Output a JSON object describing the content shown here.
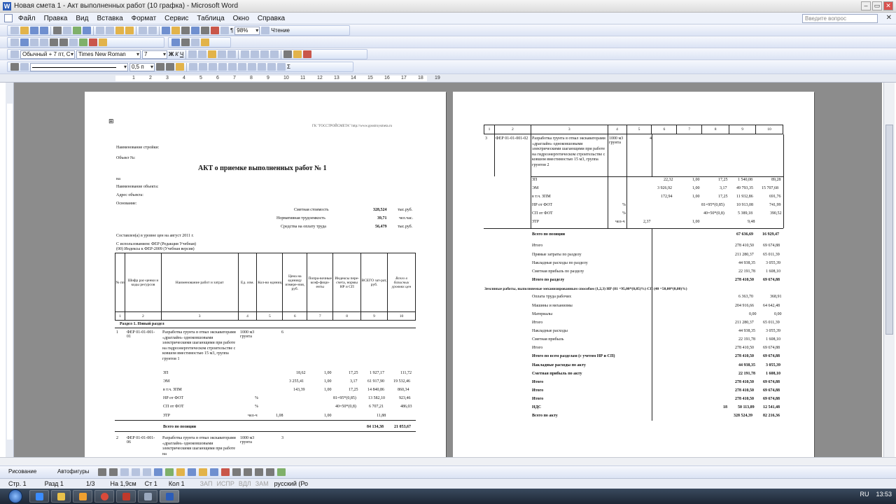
{
  "window": {
    "title": "Новая смета 1 - Акт выполненных работ (10 графка) - Microsoft Word",
    "ask_placeholder": "Введите вопрос"
  },
  "menu": [
    "Файл",
    "Правка",
    "Вид",
    "Вставка",
    "Формат",
    "Сервис",
    "Таблица",
    "Окно",
    "Справка"
  ],
  "toolbar": {
    "zoom": "98%",
    "reading": "Чтение",
    "style": "Обычный + 7 пт, С",
    "font": "Times New Roman",
    "size": "7",
    "line_width": "0,5 п"
  },
  "ruler_labels": [
    "1",
    "2",
    "3",
    "4",
    "5",
    "6",
    "7",
    "8",
    "9",
    "10",
    "11",
    "12",
    "13",
    "14",
    "15",
    "16",
    "17",
    "18",
    "19"
  ],
  "page1": {
    "header_right": "ГК \"ГОССТРОЙСМЕТА\"  http://www.gosstroysmeta.ru",
    "stroyka": "Наименование стройки:",
    "object": "Объект №:",
    "title": "АКТ о приемке выполненных работ № 1",
    "na": "на",
    "obj_name": "Наименование объекта:",
    "address": "Адрес объекта:",
    "basis": "Основание:",
    "summary": [
      {
        "label": "Сметная стоимость",
        "value": "328,524",
        "unit": "тыс.руб."
      },
      {
        "label": "Нормативная трудоемкость",
        "value": "39,71",
        "unit": "чел.час."
      },
      {
        "label": "Средства на оплату труда",
        "value": "56,479",
        "unit": "тыс.руб."
      }
    ],
    "compiled": "Составлен(а) в уровне цен на август 2011 г.",
    "using": "С использованием: ФЕР (Редакция Учебная)",
    "indexes": "(00) Индексы к ФЕР-2009 (Учебная версия)",
    "headers": [
      "№ пп",
      "Шифр рас-ценки и коды ресурсов",
      "Наименование работ и затрат",
      "Ед. изм.",
      "Кол-во единиц",
      "Цена на единицу измере-ния, руб.",
      "Попра-вочные коэф-фици-енты",
      "Индексы пере-счета, нормы НР и СП",
      "ВСЕГО зат-рат, руб.",
      "Всего в базисных уровнях цен"
    ],
    "colnums": [
      "1",
      "2",
      "3",
      "4",
      "5",
      "6",
      "7",
      "8",
      "9",
      "10"
    ],
    "section": "Раздел 1. Новый раздел",
    "item1": {
      "n": "1",
      "code": "ФЕР 01-01-001-01",
      "name": "Разработка грунта в отвал экскаваторами «драглайн» одноковшовыми электрическими шагающими при работе на гидроэнергетическом строительстве с ковшом вместимостью 15 м3, группа грунтов 1",
      "unit": "1000 м3 грунта",
      "qty": "6"
    },
    "rows1": [
      {
        "name": "ЗП",
        "unit": "",
        "qty": "",
        "price": "18,62",
        "k": "1,00",
        "idx": "17,25",
        "total": "1 927,17",
        "base": "111,72"
      },
      {
        "name": "ЭМ",
        "unit": "",
        "qty": "",
        "price": "3 255,41",
        "k": "1,00",
        "idx": "3,17",
        "total": "61 917,90",
        "base": "19 532,46"
      },
      {
        "name": "в т.ч. ЗПМ",
        "unit": "",
        "qty": "",
        "price": "143,39",
        "k": "1,00",
        "idx": "17,25",
        "total": "14 840,86",
        "base": "860,34"
      },
      {
        "name": "НР от ФОТ",
        "unit": "%",
        "qty": "",
        "price": "",
        "k": "",
        "idx": "81=95*(0,85)",
        "total": "13 582,10",
        "base": "923,46"
      },
      {
        "name": "СП от ФОТ",
        "unit": "%",
        "qty": "",
        "price": "",
        "k": "",
        "idx": "40=50*(0,8)",
        "total": "6 707,21",
        "base": "486,03"
      },
      {
        "name": "ЗТР",
        "unit": "чел-ч",
        "qty": "1,08",
        "price": "",
        "k": "1,00",
        "idx": "",
        "total": "11,88",
        "base": ""
      }
    ],
    "total_pos": {
      "label": "Всего по позиции",
      "total": "84 134,38",
      "base": "21 053,67"
    },
    "item2": {
      "n": "2",
      "code": "ФЕР 01-01-001-06",
      "name": "Разработка грунта в отвал экскаваторами «драглайн» одноковшовыми электрическими шагающими при работе на",
      "unit": "1000 м3 грунта",
      "qty": "3"
    }
  },
  "page2": {
    "colnums": [
      "1",
      "2",
      "3",
      "4",
      "5",
      "6",
      "7",
      "8",
      "9",
      "10"
    ],
    "item3": {
      "n": "3",
      "code": "ФЕР 01-01-001-02",
      "name": "Разработка грунта в отвал экскаваторами «драглайн» одноковшовыми электрическими шагающими при работе на гидроэнергетическом строительстве с ковшом вместимостью 15 м3, группа грунтов 2",
      "unit": "1000 м3 грунта",
      "qty": "4"
    },
    "rows": [
      {
        "name": "ЗП",
        "u": "",
        "q": "",
        "p": "22,32",
        "k": "1,00",
        "i": "17,25",
        "t": "1 540,08",
        "b": "89,28"
      },
      {
        "name": "ЭМ",
        "u": "",
        "q": "",
        "p": "3 926,92",
        "k": "1,00",
        "i": "3,17",
        "t": "49 793,35",
        "b": "15 707,68"
      },
      {
        "name": "в т.ч. ЗПМ",
        "u": "",
        "q": "",
        "p": "172,94",
        "k": "1,00",
        "i": "17,25",
        "t": "11 932,86",
        "b": "691,76"
      },
      {
        "name": "НР от ФОТ",
        "u": "%",
        "q": "",
        "p": "",
        "k": "",
        "i": "81=95*(0,85)",
        "t": "10 913,08",
        "b": "741,99"
      },
      {
        "name": "СП от ФОТ",
        "u": "%",
        "q": "",
        "p": "",
        "k": "",
        "i": "40=50*(0,8)",
        "t": "5 389,18",
        "b": "390,52"
      },
      {
        "name": "ЗТР",
        "u": "чел-ч",
        "q": "2,37",
        "p": "",
        "k": "1,00",
        "i": "",
        "t": "9,48",
        "b": ""
      }
    ],
    "total_pos": {
      "label": "Всего по позиции",
      "t": "67 636,69",
      "b": "16 929,47"
    },
    "totals_a": [
      {
        "label": "Итого",
        "t": "278 410,50",
        "b": "69 674,88",
        "bold": false
      },
      {
        "label": "Прямые затраты по разделу",
        "t": "211 280,37",
        "b": "65 011,39",
        "bold": false
      },
      {
        "label": "Накладные расходы по разделу",
        "t": "44 938,35",
        "b": "3 055,39",
        "bold": false
      },
      {
        "label": "Сметная прибыль по разделу",
        "t": "22 191,78",
        "b": "1 608,10",
        "bold": false
      },
      {
        "label": "Итого по разделу",
        "t": "278 410,50",
        "b": "69 674,88",
        "bold": true
      }
    ],
    "earthworks": "Земляные работы, выполняемые механизированным способом (1,2,3)  НР (81 =95,00*(0,85)%)  СП (40 =50,00*(0,80)%)",
    "totals_b": [
      {
        "label": "Оплата труда рабочих",
        "t": "6 363,70",
        "b": "368,91",
        "bold": false
      },
      {
        "label": "Машины и механизмы",
        "t": "204 916,66",
        "b": "64 642,48",
        "bold": false
      },
      {
        "label": "Материалы",
        "t": "0,00",
        "b": "0,00",
        "bold": false
      },
      {
        "label": "Итого",
        "t": "211 280,37",
        "b": "65 011,39",
        "bold": false
      },
      {
        "label": "Накладные расходы",
        "t": "44 938,35",
        "b": "3 055,39",
        "bold": false
      },
      {
        "label": "Сметная прибыль",
        "t": "22 191,78",
        "b": "1 608,10",
        "bold": false
      },
      {
        "label": "Итого",
        "t": "278 410,50",
        "b": "69 674,88",
        "bold": false
      },
      {
        "label": "Итого по всем разделам (с учетом НР и СП)",
        "t": "278 410,50",
        "b": "69 674,88",
        "bold": true
      },
      {
        "label": "Накладные расходы по акту",
        "t": "44 938,35",
        "b": "3 055,39",
        "bold": true
      },
      {
        "label": "Сметная прибыль по акту",
        "t": "22 191,78",
        "b": "1 608,10",
        "bold": true
      },
      {
        "label": "Итого",
        "t": "278 410,50",
        "b": "69 674,88",
        "bold": true
      },
      {
        "label": "Итого",
        "t": "278 410,50",
        "b": "69 674,88",
        "bold": true
      },
      {
        "label": "Итого",
        "t": "278 410,50",
        "b": "69 674,88",
        "bold": true
      }
    ],
    "nds": {
      "label": "НДС",
      "pct": "18",
      "t": "50 113,89",
      "b": "12 541,48"
    },
    "total_act": {
      "label": "Всего по акту",
      "t": "328 524,39",
      "b": "82 216,36"
    }
  },
  "draw": {
    "drawing": "Рисование",
    "autoshapes": "Автофигуры"
  },
  "status": {
    "page": "Стр. 1",
    "section": "Разд 1",
    "pages": "1/3",
    "at": "На 1,9см",
    "line": "Ст 1",
    "col": "Кол 1",
    "rec": "ЗАП",
    "trk": "ИСПР",
    "ext": "ВДЛ",
    "ovr": "ЗАМ",
    "lang": "русский (Ро"
  },
  "tray": {
    "lang": "RU",
    "time": "13:53"
  }
}
